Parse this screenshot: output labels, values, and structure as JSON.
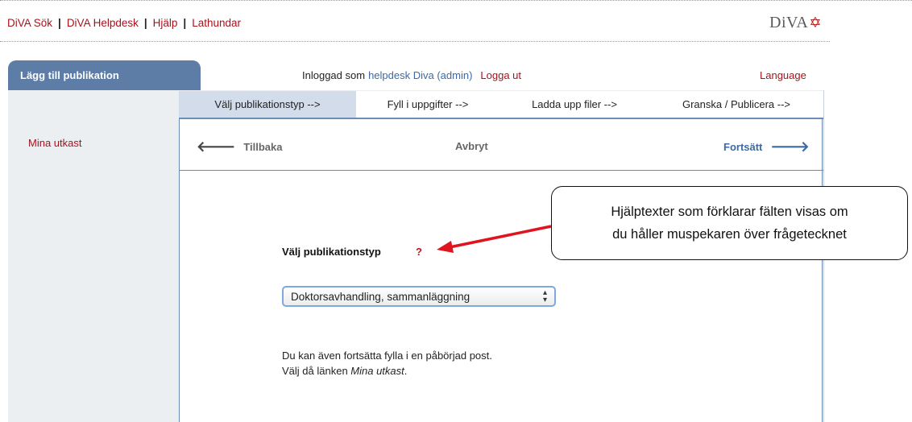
{
  "top_links": [
    "DiVA Sök",
    "DiVA Helpdesk",
    "Hjälp",
    "Lathundar"
  ],
  "logo": {
    "text": "DiVA",
    "star": "✡"
  },
  "tab_label": "Lägg till publikation",
  "header": {
    "logged_in_prefix": "Inloggad som",
    "user": "helpdesk Diva (admin)",
    "logout": "Logga ut",
    "language": "Language"
  },
  "sidebar": {
    "mina_utkast": "Mina utkast"
  },
  "steps": [
    {
      "label": "Välj publikationstyp -->",
      "active": true
    },
    {
      "label": "Fyll i uppgifter -->",
      "active": false
    },
    {
      "label": "Ladda upp filer -->",
      "active": false
    },
    {
      "label": "Granska / Publicera -->",
      "active": false
    }
  ],
  "nav": {
    "back": "Tillbaka",
    "cancel": "Avbryt",
    "continue": "Fortsätt"
  },
  "form": {
    "type_label": "Välj publikationstyp",
    "help_mark": "?",
    "selected_type": "Doktorsavhandling, sammanläggning"
  },
  "info": {
    "line1": "Du kan även fortsätta fylla i en påbörjad post.",
    "line2_prefix": "Välj då länken ",
    "line2_link": "Mina utkast",
    "line2_suffix": "."
  },
  "callout": {
    "line1": "Hjälptexter som förklarar fälten visas om",
    "line2": "du håller muspekaren över frågetecknet"
  },
  "colors": {
    "link_red": "#a8121b",
    "tab_blue": "#5d7ca6",
    "accent_blue": "#3d6aa0",
    "arrow_red": "#e0141e"
  }
}
